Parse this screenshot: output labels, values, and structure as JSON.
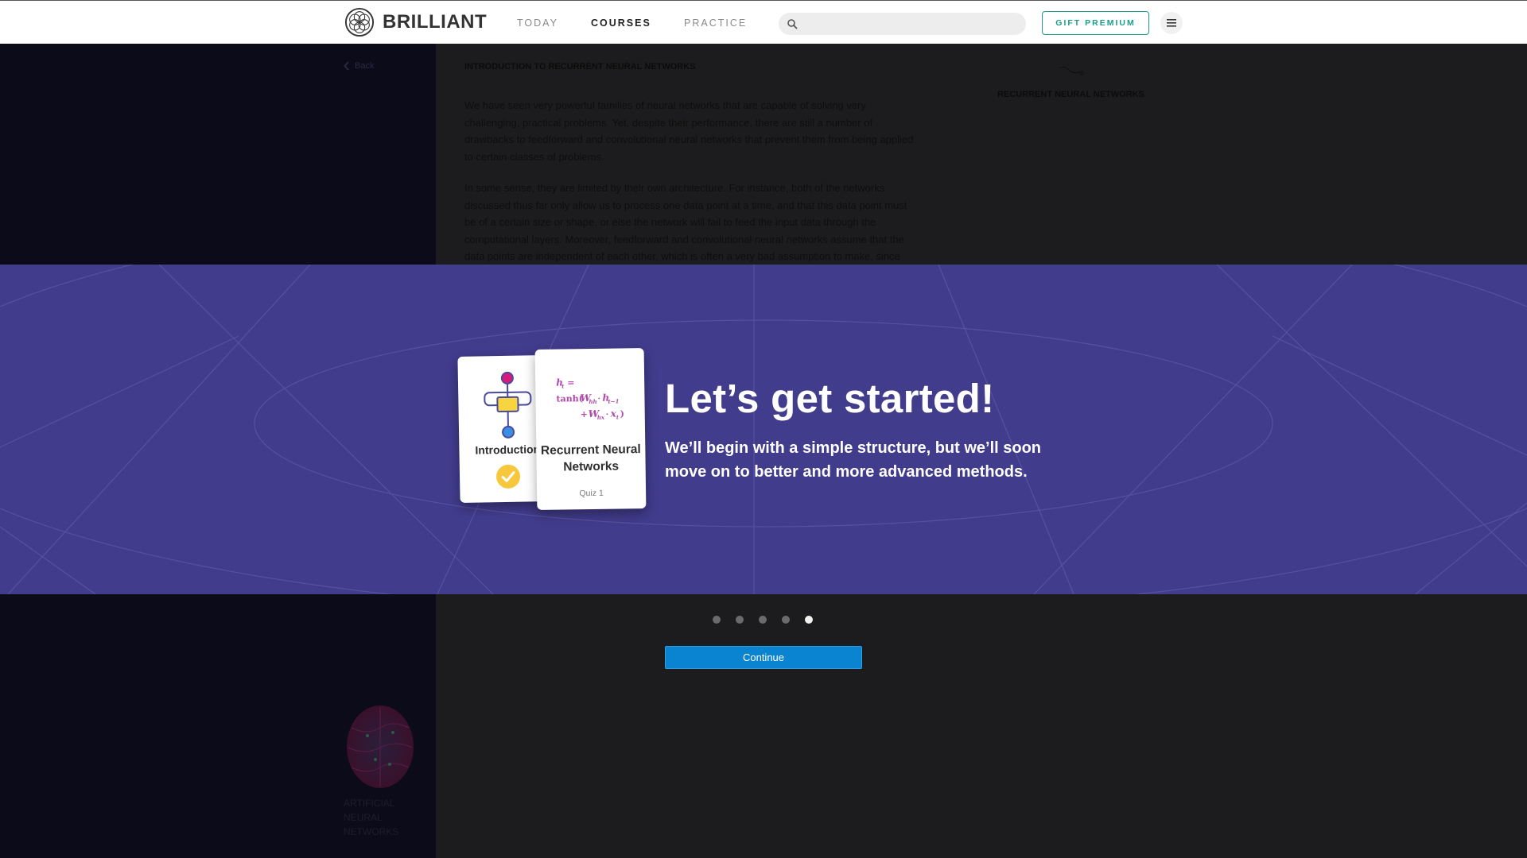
{
  "nav": {
    "brand": "BRILLIANT",
    "links": [
      {
        "label": "TODAY",
        "active": false
      },
      {
        "label": "COURSES",
        "active": true
      },
      {
        "label": "PRACTICE",
        "active": false
      }
    ],
    "search_placeholder": "",
    "gift_label": "GIFT PREMIUM",
    "menu_icon": "hamburger-icon"
  },
  "background_page": {
    "back_label": "Back",
    "article_title": "INTRODUCTION TO RECURRENT NEURAL NETWORKS",
    "paragraphs": [
      "We have seen very powerful families of neural networks that are capable of solving very challenging, practical problems. Yet, despite their performance, there are still a number of drawbacks to feedforward and convolutional neural networks that prevent them from being applied to certain classes of problems.",
      "In some sense, they are limited by their own architecture. For instance, both of the networks discussed thus far only allow us to process one data point at a time, and that this data point must be of a certain size or shape, or else the network will fail to feed the input data through the computational layers. Moreover, feedforward and convolutional neural networks assume that the data points are independent of each other, which is often a very bad assumption to make, since"
    ],
    "right_panel_title": "RECURRENT NEURAL NETWORKS",
    "course_name": "ARTIFICIAL NEURAL NETWORKS"
  },
  "modal": {
    "cards": {
      "intro_label": "Introduction",
      "rnn_label": "Recurrent Neural Networks",
      "rnn_sub": "Quiz 1"
    },
    "headline": "Let’s get started!",
    "subline": "We’ll begin with a simple structure, but we’ll soon move on to better and more advanced methods."
  },
  "pager": {
    "count": 5,
    "active_index": 4
  },
  "continue_label": "Continue",
  "colors": {
    "band": "#413c8c",
    "continue": "#0a83d0",
    "gift": "#1b9d8a",
    "formula": "#b04aa8"
  }
}
